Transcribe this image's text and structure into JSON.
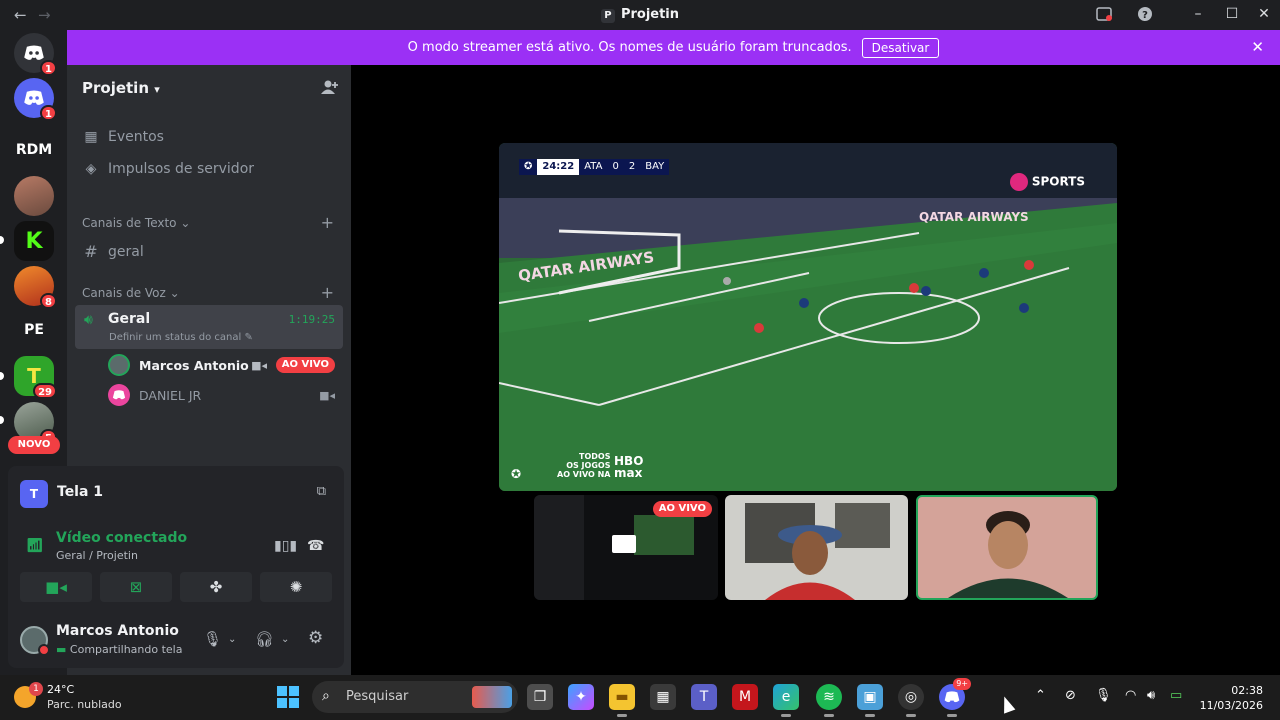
{
  "window": {
    "title": "Projetin",
    "title_initial": "P",
    "nav_back": "←",
    "nav_forward": "→",
    "icons": [
      "inbox-icon",
      "help-icon"
    ]
  },
  "banner": {
    "text": "O modo streamer está ativo. Os nomes de usuário foram truncados.",
    "button": "Desativar"
  },
  "rail": {
    "servers": [
      {
        "label": "",
        "badge": "1"
      },
      {
        "label": "",
        "badge": "1"
      },
      {
        "label": "RDM",
        "badge": ""
      },
      {
        "label": "",
        "badge": ""
      },
      {
        "label": "",
        "badge": ""
      },
      {
        "label": "",
        "badge": "8"
      },
      {
        "label": "PE",
        "badge": ""
      },
      {
        "label": "",
        "badge": "29"
      },
      {
        "label": "",
        "badge": "5"
      }
    ],
    "novo": "NOVO"
  },
  "sidebar": {
    "guild_name": "Projetin",
    "events": "Eventos",
    "boosts": "Impulsos de servidor",
    "text_category": "Canais de Texto",
    "text_channel": "geral",
    "voice_category": "Canais de Voz",
    "voice_channel": {
      "name": "Geral",
      "timer": "1:19:25",
      "status": "Definir um status do canal"
    },
    "voice_users": [
      {
        "name": "Marcos Antonio",
        "live": "AO VIVO"
      },
      {
        "name": "DANIEL JR"
      }
    ]
  },
  "panel": {
    "stream_name": "Tela 1",
    "stream_initial": "T",
    "status": "Vídeo conectado",
    "location": "Geral / Projetin",
    "user_name": "Marcos Antonio",
    "user_status": "Compartilhando tela"
  },
  "stage": {
    "scoreboard": {
      "clock": "24:22",
      "home": "ATA",
      "home_score": "0",
      "away_score": "2",
      "away": "BAY"
    },
    "broadcaster": "SPORTS",
    "hbo_text": "TODOS\nOS JOGOS\nAO VIVO NA",
    "hbo_logo": "HBO\nmax",
    "thumbs": [
      {
        "live": "AO VIVO"
      },
      {},
      {}
    ]
  },
  "taskbar": {
    "temperature": "24°C",
    "condition": "Parc. nublado",
    "weather_badge": "1",
    "search_placeholder": "Pesquisar",
    "discord_badge": "9+",
    "time": "02:38",
    "date": "11/03/2026"
  },
  "colors": {
    "banner": "#9b30f5",
    "green": "#23a55a",
    "live_red": "#f23f43",
    "sidebar_bg": "#2b2d31",
    "rail_bg": "#1e1f22"
  }
}
